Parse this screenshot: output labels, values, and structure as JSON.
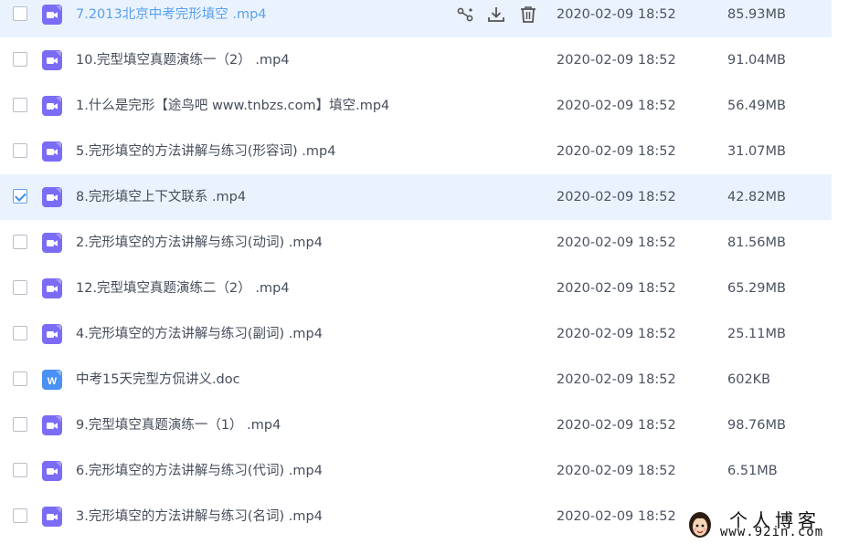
{
  "files": [
    {
      "name": "7.2013北京中考完形填空  .mp4",
      "date": "2020-02-09 18:52",
      "size": "85.93MB",
      "type": "video",
      "state": "hover",
      "checked": false
    },
    {
      "name": "10.完型填空真题演练一（2）  .mp4",
      "date": "2020-02-09 18:52",
      "size": "91.04MB",
      "type": "video",
      "state": "",
      "checked": false
    },
    {
      "name": "1.什么是完形【途鸟吧 www.tnbzs.com】填空.mp4",
      "date": "2020-02-09 18:52",
      "size": "56.49MB",
      "type": "video",
      "state": "",
      "checked": false
    },
    {
      "name": "5.完形填空的方法讲解与练习(形容词)  .mp4",
      "date": "2020-02-09 18:52",
      "size": "31.07MB",
      "type": "video",
      "state": "",
      "checked": false
    },
    {
      "name": "8.完形填空上下文联系  .mp4",
      "date": "2020-02-09 18:52",
      "size": "42.82MB",
      "type": "video",
      "state": "selected",
      "checked": true
    },
    {
      "name": "2.完形填空的方法讲解与练习(动词)  .mp4",
      "date": "2020-02-09 18:52",
      "size": "81.56MB",
      "type": "video",
      "state": "",
      "checked": false
    },
    {
      "name": "12.完型填空真题演练二（2）  .mp4",
      "date": "2020-02-09 18:52",
      "size": "65.29MB",
      "type": "video",
      "state": "",
      "checked": false
    },
    {
      "name": "4.完形填空的方法讲解与练习(副词)  .mp4",
      "date": "2020-02-09 18:52",
      "size": "25.11MB",
      "type": "video",
      "state": "",
      "checked": false
    },
    {
      "name": "中考15天完型方侃讲义.doc",
      "date": "2020-02-09 18:52",
      "size": "602KB",
      "type": "word",
      "state": "",
      "checked": false
    },
    {
      "name": "9.完型填空真题演练一（1）  .mp4",
      "date": "2020-02-09 18:52",
      "size": "98.76MB",
      "type": "video",
      "state": "",
      "checked": false
    },
    {
      "name": "6.完形填空的方法讲解与练习(代词)  .mp4",
      "date": "2020-02-09 18:52",
      "size": "6.51MB",
      "type": "video",
      "state": "",
      "checked": false
    },
    {
      "name": "3.完形填空的方法讲解与练习(名词)  .mp4",
      "date": "2020-02-09 18:52",
      "size": "",
      "type": "video",
      "state": "",
      "checked": false
    }
  ],
  "row_actions": {
    "share_icon": "share-icon",
    "download_icon": "download-icon",
    "delete_icon": "trash-icon"
  },
  "watermark": {
    "top": "个人博客",
    "bottom": "www.92in.com"
  },
  "colors": {
    "accent": "#5aa0f0",
    "row_highlight": "#eaf3fd",
    "video_icon": "#7b6cf6",
    "word_icon": "#4a90f5",
    "text": "#454d5a"
  }
}
